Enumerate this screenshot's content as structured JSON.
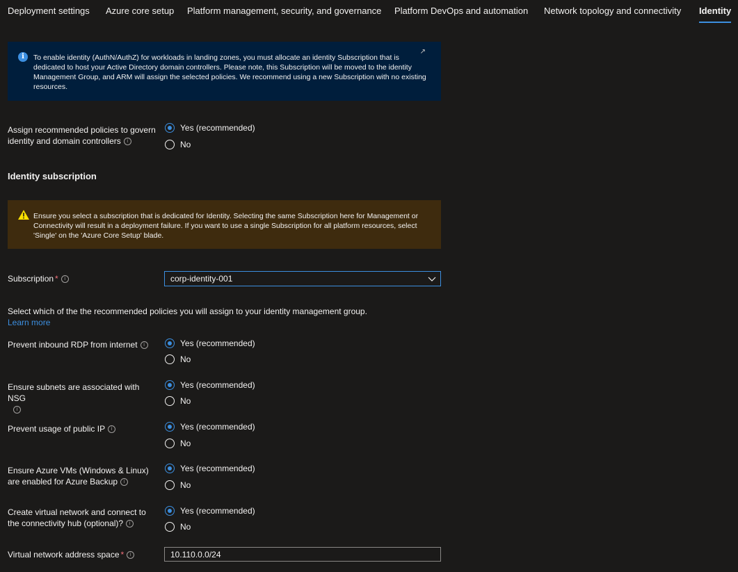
{
  "tabs": [
    "Deployment settings",
    "Azure core setup",
    "Platform management, security, and governance",
    "Platform DevOps and automation",
    "Network topology and connectivity",
    "Identity"
  ],
  "info_banner": {
    "text": "To enable identity (AuthN/AuthZ) for workloads in landing zones, you must allocate an identity Subscription that is dedicated to host your Active Directory domain controllers. Please note, this Subscription will be moved to the identity Management Group, and ARM will assign the selected policies. We recommend using a new Subscription with no existing resources."
  },
  "assign_policies": {
    "label": "Assign recommended policies to govern identity and domain controllers",
    "yes": "Yes (recommended)",
    "no": "No"
  },
  "identity_subscription": {
    "title": "Identity subscription",
    "warning": "Ensure you select a subscription that is dedicated for Identity. Selecting the same Subscription here for Management or Connectivity will result in a deployment failure. If you want to use a single Subscription for all platform resources, select 'Single' on the 'Azure Core Setup' blade.",
    "subscription_label": "Subscription",
    "subscription_value": "corp-identity-001"
  },
  "policies_intro": {
    "text": "Select which of the the recommended policies you will assign to your identity management group.",
    "link": "Learn more"
  },
  "policies": [
    {
      "label": "Prevent inbound RDP from internet",
      "yes": "Yes (recommended)",
      "no": "No"
    },
    {
      "label": "Ensure subnets are associated with NSG",
      "yes": "Yes (recommended)",
      "no": "No"
    },
    {
      "label": "Prevent usage of public IP",
      "yes": "Yes (recommended)",
      "no": "No"
    },
    {
      "label": "Ensure Azure VMs (Windows & Linux) are enabled for Azure Backup",
      "yes": "Yes (recommended)",
      "no": "No"
    },
    {
      "label": "Create virtual network and connect to the connectivity hub (optional)?",
      "yes": "Yes (recommended)",
      "no": "No"
    }
  ],
  "vnet": {
    "label": "Virtual network address space",
    "value": "10.110.0.0/24"
  },
  "colors": {
    "background": "#1b1a19",
    "accent": "#3c8fe0",
    "info_banner": "#001e3c",
    "warning_banner": "#3e2b0e",
    "required": "#f1707b"
  }
}
